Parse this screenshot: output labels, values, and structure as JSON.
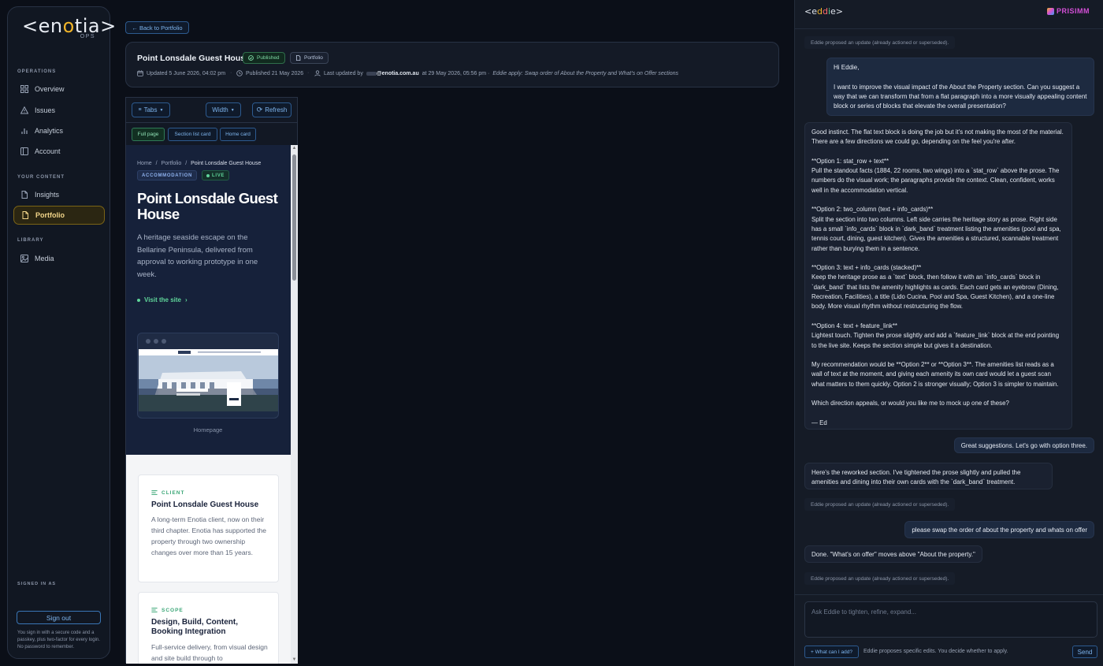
{
  "sidebar": {
    "logo_open": "<en",
    "logo_o": "o",
    "logo_close": "tia>",
    "logo_sub": "OPS",
    "sections": {
      "operations": "OPERATIONS",
      "content": "YOUR CONTENT",
      "library": "LIBRARY"
    },
    "items": [
      {
        "label": "Overview",
        "icon": "grid-icon"
      },
      {
        "label": "Issues",
        "icon": "warning-icon"
      },
      {
        "label": "Analytics",
        "icon": "bar-chart-icon"
      },
      {
        "label": "Account",
        "icon": "panel-icon"
      },
      {
        "label": "Insights",
        "icon": "document-icon"
      },
      {
        "label": "Portfolio",
        "icon": "document-icon"
      },
      {
        "label": "Media",
        "icon": "image-icon"
      }
    ],
    "active_item": "Portfolio",
    "signed_in_label": "SIGNED IN AS",
    "sign_out": "Sign out",
    "sign_note": "You sign in with a secure code and a passkey, plus two-factor for every login. No password to remember."
  },
  "header": {
    "back": "← Back to Portfolio",
    "title": "Point Lonsdale Guest House",
    "status_badge": "Published",
    "section_badge": "Portfolio",
    "updated": "Updated 5 June 2026, 04:02 pm",
    "published": "Published 21 May 2026",
    "last_updated_prefix": "Last updated by",
    "last_updated_email": "@enotia.com.au",
    "last_updated_at": "at 29 May 2026, 05:56 pm ·",
    "last_updated_note": "Eddie apply: Swap order of About the Property and What's on Offer sections"
  },
  "preview": {
    "toolbar": {
      "tabs": "Tabs",
      "width": "Width",
      "refresh": "Refresh"
    },
    "view_tabs": [
      "Full page",
      "Section list card",
      "Home card"
    ],
    "active_view": "Full page",
    "breadcrumb": {
      "home": "Home",
      "sep": "/",
      "portfolio": "Portfolio",
      "current": "Point Lonsdale Guest House"
    },
    "category": "ACCOMMODATION",
    "live": "LIVE",
    "title": "Point Lonsdale Guest House",
    "lead": "A heritage seaside escape on the Bellarine Peninsula, delivered from approval to working prototype in one week.",
    "visit": "Visit the site",
    "visit_arrow": "›",
    "caption": "Homepage",
    "cards": [
      {
        "eyebrow": "CLIENT",
        "title": "Point Lonsdale Guest House",
        "body": "A long-term Enotia client, now on their third chapter. Enotia has supported the property through two ownership changes over more than 15 years."
      },
      {
        "eyebrow": "SCOPE",
        "title": "Design, Build, Content, Booking Integration",
        "body": "Full-service delivery, from visual design and site build through to"
      }
    ]
  },
  "chat": {
    "logo_open": "<e",
    "logo_d1": "d",
    "logo_d2": "d",
    "logo_i": "i",
    "logo_close": "e>",
    "brand": "PRISIMM",
    "messages": [
      {
        "role": "note",
        "text": "Eddie proposed an update (already actioned or superseded)."
      },
      {
        "role": "user",
        "text": "Hi Eddie,\n\nI want to improve the visual impact of the About the Property section. Can you suggest a way that we can transform that from a flat paragraph into a more visually appealing content block or series of blocks that elevate the overall presentation?"
      },
      {
        "role": "ed",
        "text": "Good instinct. The flat text block is doing the job but it's not making the most of the material. There are a few directions we could go, depending on the feel you're after.\n\n**Option 1: stat_row + text**\nPull the standout facts (1884, 22 rooms, two wings) into a `stat_row` above the prose. The numbers do the visual work; the paragraphs provide the context. Clean, confident, works well in the accommodation vertical.\n\n**Option 2: two_column (text + info_cards)**\nSplit the section into two columns. Left side carries the heritage story as prose. Right side has a small `info_cards` block in `dark_band` treatment listing the amenities (pool and spa, tennis court, dining, guest kitchen). Gives the amenities a structured, scannable treatment rather than burying them in a sentence.\n\n**Option 3: text + info_cards (stacked)**\nKeep the heritage prose as a `text` block, then follow it with an `info_cards` block in `dark_band` that lists the amenity highlights as cards. Each card gets an eyebrow (Dining, Recreation, Facilities), a title (Lido Cucina, Pool and Spa, Guest Kitchen), and a one-line body. More visual rhythm without restructuring the flow.\n\n**Option 4: text + feature_link**\nLightest touch. Tighten the prose slightly and add a `feature_link` block at the end pointing to the live site. Keeps the section simple but gives it a destination.\n\nMy recommendation would be **Option 2** or **Option 3**. The amenities list reads as a wall of text at the moment, and giving each amenity its own card would let a guest scan what matters to them quickly. Option 2 is stronger visually; Option 3 is simpler to maintain.\n\nWhich direction appeals, or would you like me to mock up one of these?\n\n— Ed"
      },
      {
        "role": "user",
        "text": "Great suggestions. Let's go with option three."
      },
      {
        "role": "ed",
        "text": "Here's the reworked section. I've tightened the prose slightly and pulled the amenities and dining into their own cards with the `dark_band` treatment."
      },
      {
        "role": "note",
        "text": "Eddie proposed an update (already actioned or superseded)."
      },
      {
        "role": "user",
        "text": "please swap the order of about the property and whats on offer"
      },
      {
        "role": "ed",
        "text": "Done. \"What's on offer\" moves above \"About the property.\""
      },
      {
        "role": "note",
        "text": "Eddie proposed an update (already actioned or superseded)."
      }
    ],
    "input_placeholder": "Ask Eddie to tighten, refine, expand...",
    "what_can_i_add": "+ What can I add?",
    "footnote": "Eddie proposes specific edits. You decide whether to apply.",
    "send": "Send"
  }
}
